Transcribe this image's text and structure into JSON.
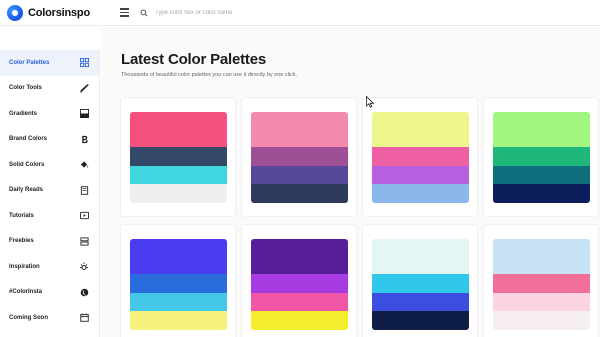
{
  "app": {
    "name": "Colorsinspo"
  },
  "search": {
    "placeholder": "Type color hex or color name"
  },
  "sidebar": {
    "items": [
      {
        "label": "Color Palettes",
        "icon": "grid-icon",
        "active": true
      },
      {
        "label": "Color Tools",
        "icon": "brush-icon",
        "active": false
      },
      {
        "label": "Gradients",
        "icon": "gradient-icon",
        "active": false
      },
      {
        "label": "Brand Colors",
        "icon": "letter-b-icon",
        "active": false
      },
      {
        "label": "Solid Colors",
        "icon": "paint-bucket-icon",
        "active": false
      },
      {
        "label": "Daily Reads",
        "icon": "book-icon",
        "active": false
      },
      {
        "label": "Tutorials",
        "icon": "play-icon",
        "active": false
      },
      {
        "label": "Freebies",
        "icon": "gift-icon",
        "active": false
      },
      {
        "label": "Inspiration",
        "icon": "sun-icon",
        "active": false
      },
      {
        "label": "#ColorInsta",
        "icon": "globe-icon",
        "active": false
      },
      {
        "label": "Coming Soon",
        "icon": "calendar-icon",
        "active": false
      }
    ]
  },
  "main": {
    "title": "Latest Color Palettes",
    "subtitle": "Thousands of beautiful color palettes you can use it directly by one click."
  },
  "palettes": [
    [
      "#f5507e",
      "#34486a",
      "#3fd6e0",
      "#efefef"
    ],
    [
      "#f48aab",
      "#9f4f96",
      "#55489a",
      "#2e3a5c"
    ],
    [
      "#eef68e",
      "#ef5fa4",
      "#b85fe0",
      "#8ab8ec"
    ],
    [
      "#a2f57e",
      "#1fb77a",
      "#0f6f7c",
      "#0d1e5c"
    ],
    [
      "#4b3cf2",
      "#2b6cdc",
      "#45c8e8",
      "#f6f27e"
    ],
    [
      "#571e9a",
      "#a73be2",
      "#f155a6",
      "#f4ee2e"
    ],
    [
      "#e3f5f5",
      "#2fc7ea",
      "#3b4ee0",
      "#0f1e46"
    ],
    [
      "#c8e2f5",
      "#f26f9c",
      "#fbd4e0",
      "#f6eef2"
    ]
  ]
}
